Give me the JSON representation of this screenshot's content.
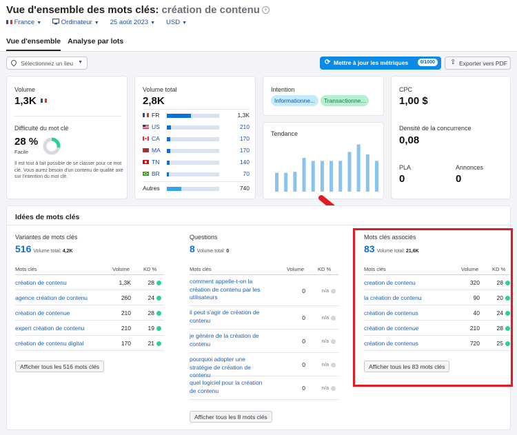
{
  "header": {
    "title": "Vue d'ensemble des mots clés:",
    "keyword": "création de contenu",
    "plus_glyph": "+",
    "filters": {
      "country": "France",
      "device": "Ordinateur",
      "date": "25 août 2023",
      "currency": "USD"
    },
    "tabs": [
      {
        "label": "Vue d'ensemble",
        "active": true
      },
      {
        "label": "Analyse par lots",
        "active": false
      }
    ]
  },
  "toolbar": {
    "location_placeholder": "Sélectionnez un lieu",
    "update_label": "Mettre à jour les métriques",
    "update_badge": "0/1000",
    "pdf_label": "Exporter vers PDF"
  },
  "volume_card": {
    "label": "Volume",
    "value": "1,3K",
    "difficulty_label": "Difficulté du mot clé",
    "difficulty_value": "28 %",
    "difficulty_percent": 28,
    "difficulty_text": "Facile",
    "description": "Il est tout à fait possible de se classer pour ce mot clé. Vous aurez besoin d'un contenu de qualité axé sur l'intention du mot clé."
  },
  "total_volume_card": {
    "label": "Volume total",
    "value": "2,8K",
    "rows": [
      {
        "code": "FR",
        "value": "1,3K",
        "fraction": 0.46
      },
      {
        "code": "US",
        "value": "210",
        "fraction": 0.08
      },
      {
        "code": "CA",
        "value": "170",
        "fraction": 0.065
      },
      {
        "code": "MA",
        "value": "170",
        "fraction": 0.065
      },
      {
        "code": "TN",
        "value": "140",
        "fraction": 0.055
      },
      {
        "code": "BR",
        "value": "70",
        "fraction": 0.035
      }
    ],
    "others_label": "Autres",
    "others_value": "740",
    "others_fraction": 0.27
  },
  "intent_card": {
    "label": "Intention",
    "pills": [
      "Informationne...",
      "Transactionne..."
    ],
    "colors": {
      "info": "#c3ecfb",
      "trans": "#b6f0cf"
    }
  },
  "trend_card": {
    "label": "Tendance",
    "bars": [
      0.38,
      0.38,
      0.4,
      0.68,
      0.62,
      0.62,
      0.62,
      0.62,
      0.8,
      0.95,
      0.75,
      0.62
    ]
  },
  "cpc_card": {
    "cpc_label": "CPC",
    "cpc_value": "1,00 $",
    "density_label": "Densité de la concurrence",
    "density_value": "0,08",
    "pla_label": "PLA",
    "pla_value": "0",
    "ads_label": "Annonces",
    "ads_value": "0"
  },
  "ideas": {
    "title": "Idées de mots clés",
    "headers": {
      "kw": "Mots clés",
      "vol": "Volume",
      "kd": "KD %"
    },
    "volume_total_label": "Volume total:",
    "variants": {
      "title": "Variantes de mots clés",
      "count": "516",
      "volume_total": "4,2K",
      "rows": [
        {
          "kw": "création de contenu",
          "vol": "1,3K",
          "kd": "28"
        },
        {
          "kw": "agence création de contenu",
          "vol": "260",
          "kd": "24"
        },
        {
          "kw": "création de contenue",
          "vol": "210",
          "kd": "28"
        },
        {
          "kw": "expert création de contenu",
          "vol": "210",
          "kd": "19"
        },
        {
          "kw": "création de contenu digital",
          "vol": "170",
          "kd": "21"
        }
      ],
      "button": "Afficher tous les 516 mots clés"
    },
    "questions": {
      "title": "Questions",
      "count": "8",
      "volume_total": "0",
      "rows": [
        {
          "kw": "comment appelle-t-on la création de contenu par les utilisateurs",
          "vol": "0",
          "kd": "n/a"
        },
        {
          "kw": "il peut s'agir de création de contenu",
          "vol": "0",
          "kd": "n/a"
        },
        {
          "kw": "je génère de la création de contenu",
          "vol": "0",
          "kd": "n/a"
        },
        {
          "kw": "pourquoi adopter une stratégie de création de contenu",
          "vol": "0",
          "kd": "n/a"
        },
        {
          "kw": "quel logiciel pour la création de contenu",
          "vol": "0",
          "kd": "n/a"
        }
      ],
      "button": "Afficher tous les 8 mots clés"
    },
    "related": {
      "title": "Mots clés associés",
      "count": "83",
      "volume_total": "21,6K",
      "rows": [
        {
          "kw": "creation de contenu",
          "vol": "320",
          "kd": "28"
        },
        {
          "kw": "la création de contenu",
          "vol": "90",
          "kd": "20"
        },
        {
          "kw": "création de contenus",
          "vol": "40",
          "kd": "24"
        },
        {
          "kw": "création de contenue",
          "vol": "210",
          "kd": "28"
        },
        {
          "kw": "création de contenus",
          "vol": "720",
          "kd": "25"
        }
      ],
      "button": "Afficher tous les 83 mots clés"
    }
  },
  "colors": {
    "accent": "#0d8ae6",
    "link": "#1d5fb5",
    "easy_green": "#2bd09a",
    "highlight_red": "#e01b22"
  }
}
